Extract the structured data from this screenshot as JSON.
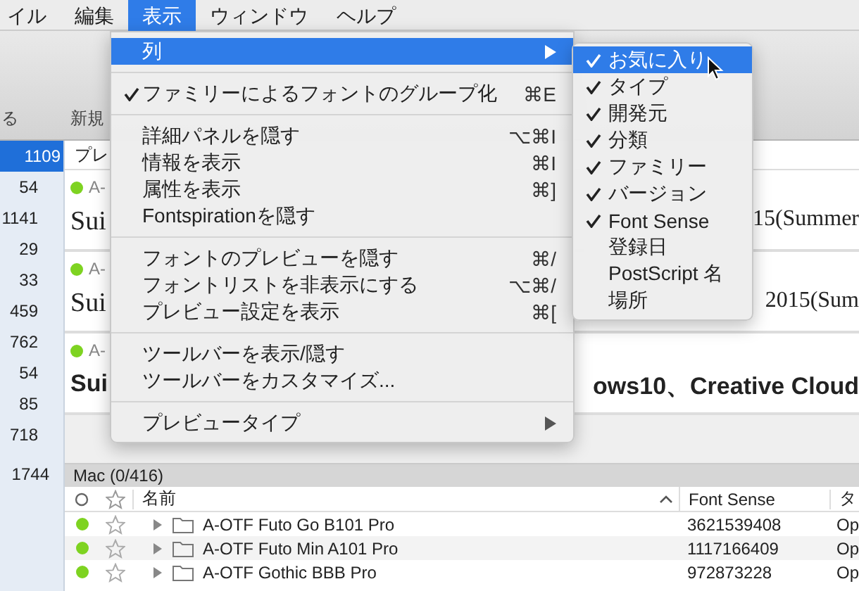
{
  "menubar": [
    {
      "label": "イル",
      "selected": false
    },
    {
      "label": "編集",
      "selected": false
    },
    {
      "label": "表示",
      "selected": true
    },
    {
      "label": "ウィンドウ",
      "selected": false
    },
    {
      "label": "ヘルプ",
      "selected": false
    }
  ],
  "toolbar": {
    "labels": [
      "る",
      "新規"
    ]
  },
  "sidebar": {
    "counts": [
      {
        "text": "1109",
        "selected": true
      },
      {
        "text": "54",
        "selected": false
      },
      {
        "text": "1141",
        "selected": false
      },
      {
        "text": "29",
        "selected": false
      },
      {
        "text": "33",
        "selected": false
      },
      {
        "text": "459",
        "selected": false
      },
      {
        "text": "762",
        "selected": false
      },
      {
        "text": "54",
        "selected": false
      },
      {
        "text": "85",
        "selected": false
      },
      {
        "text": "718",
        "selected": false
      },
      {
        "text": "1744",
        "selected": false
      }
    ]
  },
  "preview": {
    "header": "プレ",
    "cards": [
      {
        "tag": "A-",
        "sample_left": "Sui",
        "sample_right": "15(Summer",
        "bold": false
      },
      {
        "tag": "A-",
        "sample_left": "Sui",
        "sample_right": "2015(Sum",
        "bold": false
      },
      {
        "tag": "A-",
        "sample_left": "Sui",
        "sample_right": "ows10、Creative Cloud",
        "bold": true
      }
    ]
  },
  "font_list": {
    "title": "Mac (0/416)",
    "columns": [
      "名前",
      "Font Sense",
      "タ"
    ],
    "rows": [
      {
        "active": true,
        "favorite": false,
        "name": "A-OTF Futo Go B101 Pro",
        "font_sense": "3621539408",
        "column_4": "Op"
      },
      {
        "active": true,
        "favorite": false,
        "name": "A-OTF Futo Min A101 Pro",
        "font_sense": "1117166409",
        "column_4": "Op"
      },
      {
        "active": true,
        "favorite": false,
        "name": "A-OTF Gothic BBB Pro",
        "font_sense": "972873228",
        "column_4": "Op"
      }
    ]
  },
  "view_menu": {
    "items": [
      {
        "kind": "item",
        "label": "列",
        "checked": false,
        "selected": true,
        "has_submenu": true
      },
      {
        "kind": "separator"
      },
      {
        "kind": "item",
        "label": "ファミリーによるフォントのグループ化",
        "checked": true,
        "selected": false,
        "shortcut": "⌘E",
        "has_submenu": false
      },
      {
        "kind": "separator"
      },
      {
        "kind": "item",
        "label": "詳細パネルを隠す",
        "checked": false,
        "selected": false,
        "shortcut": "⌥⌘I",
        "has_submenu": false
      },
      {
        "kind": "item",
        "label": "情報を表示",
        "checked": false,
        "selected": false,
        "shortcut": "⌘I",
        "has_submenu": false
      },
      {
        "kind": "item",
        "label": "属性を表示",
        "checked": false,
        "selected": false,
        "shortcut": "⌘]",
        "has_submenu": false
      },
      {
        "kind": "item",
        "label": "Fontspirationを隠す",
        "checked": false,
        "selected": false,
        "has_submenu": false
      },
      {
        "kind": "separator"
      },
      {
        "kind": "item",
        "label": "フォントのプレビューを隠す",
        "checked": false,
        "selected": false,
        "shortcut": "⌘/",
        "has_submenu": false
      },
      {
        "kind": "item",
        "label": "フォントリストを非表示にする",
        "checked": false,
        "selected": false,
        "shortcut": "⌥⌘/",
        "has_submenu": false
      },
      {
        "kind": "item",
        "label": "プレビュー設定を表示",
        "checked": false,
        "selected": false,
        "shortcut": "⌘[",
        "has_submenu": false
      },
      {
        "kind": "separator"
      },
      {
        "kind": "item",
        "label": "ツールバーを表示/隠す",
        "checked": false,
        "selected": false,
        "has_submenu": false
      },
      {
        "kind": "item",
        "label": "ツールバーをカスタマイズ...",
        "checked": false,
        "selected": false,
        "has_submenu": false
      },
      {
        "kind": "separator"
      },
      {
        "kind": "item",
        "label": "プレビュータイプ",
        "checked": false,
        "selected": false,
        "has_submenu": true
      }
    ]
  },
  "columns_submenu": {
    "items": [
      {
        "label": "お気に入り",
        "checked": true,
        "selected": true
      },
      {
        "label": "タイプ",
        "checked": true,
        "selected": false
      },
      {
        "label": "開発元",
        "checked": true,
        "selected": false
      },
      {
        "label": "分類",
        "checked": true,
        "selected": false
      },
      {
        "label": "ファミリー",
        "checked": true,
        "selected": false
      },
      {
        "label": "バージョン",
        "checked": true,
        "selected": false
      },
      {
        "label": "Font Sense",
        "checked": true,
        "selected": false
      },
      {
        "label": "登録日",
        "checked": false,
        "selected": false
      },
      {
        "label": "PostScript 名",
        "checked": false,
        "selected": false
      },
      {
        "label": "場所",
        "checked": false,
        "selected": false
      }
    ]
  }
}
